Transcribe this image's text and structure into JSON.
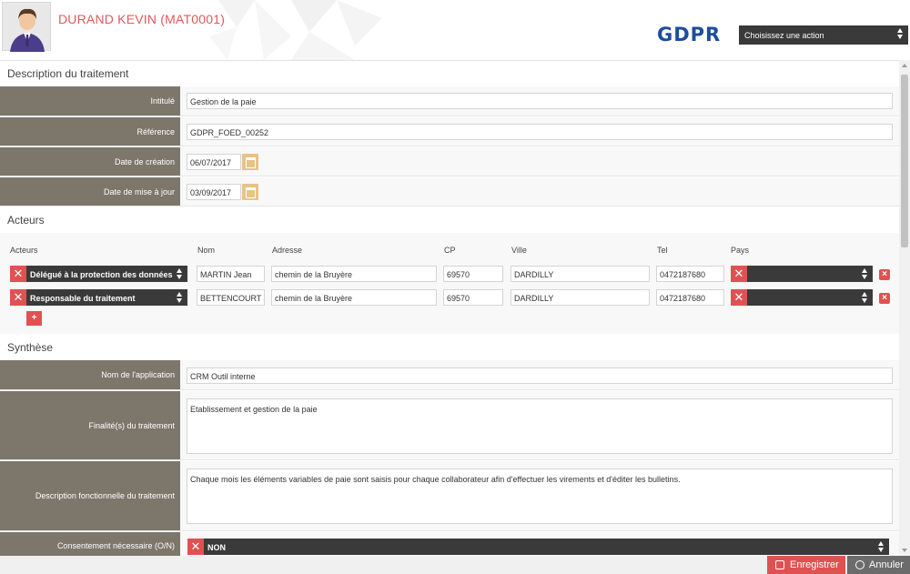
{
  "header": {
    "user_name": "DURAND KEVIN (MAT0001)",
    "logo_text": "GDPR",
    "action_select": "Choisissez une action"
  },
  "description": {
    "title": "Description du traitement",
    "fields": [
      {
        "label": "Intitulé",
        "value": "Gestion de la paie"
      },
      {
        "label": "Référence",
        "value": "GDPR_FOED_00252"
      },
      {
        "label": "Date de création",
        "value": "06/07/2017"
      },
      {
        "label": "Date de mise à jour",
        "value": "03/09/2017"
      }
    ]
  },
  "acteurs": {
    "title": "Acteurs",
    "columns": [
      "Acteurs",
      "Nom",
      "Adresse",
      "CP",
      "Ville",
      "Tel",
      "Pays"
    ],
    "rows": [
      {
        "role": "Délégué à la protection des données",
        "nom": "MARTIN Jean",
        "adresse": "chemin de la Bruyère",
        "cp": "69570",
        "ville": "DARDILLY",
        "tel": "0472187680",
        "pays": ""
      },
      {
        "role": "Responsable du traitement",
        "nom": "BETTENCOURT J",
        "adresse": "chemin de la Bruyère",
        "cp": "69570",
        "ville": "DARDILLY",
        "tel": "0472187680",
        "pays": ""
      }
    ],
    "add_label": "+"
  },
  "synthese": {
    "title": "Synthèse",
    "nom_application": {
      "label": "Nom de l'application",
      "value": "CRM Outil interne"
    },
    "finalites": {
      "label": "Finalité(s) du traitement",
      "value": "Etablissement et gestion de la paie"
    },
    "description_fonctionnelle": {
      "label": "Description fonctionnelle du traitement",
      "value": "Chaque mois les éléments variables de paie sont saisis pour chaque collaborateur afin d'effectuer les virements et d'éditer les bulletins."
    },
    "consentement": {
      "label": "Consentement nécessaire (O/N)",
      "value": "NON"
    }
  },
  "footer": {
    "save_label": "Enregistrer",
    "cancel_label": "Annuler"
  },
  "colors": {
    "accent_red": "#e05252",
    "label_bg": "#7d766b",
    "dark_select": "#3a3a3a",
    "logo_blue": "#1d4e9b",
    "calendar": "#e8c387"
  }
}
